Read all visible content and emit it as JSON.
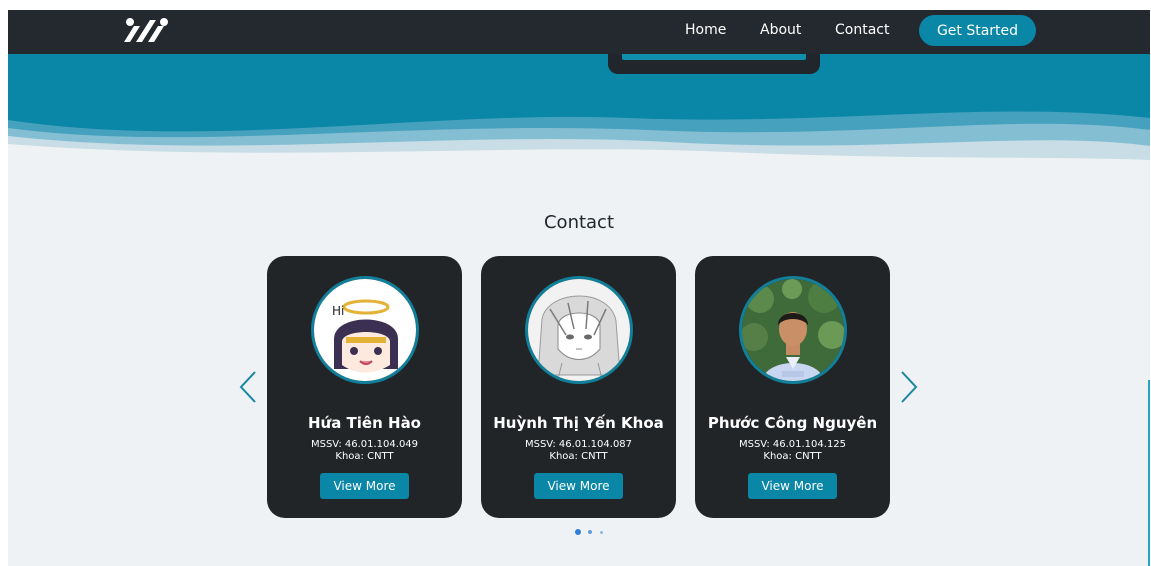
{
  "nav": {
    "home": "Home",
    "about": "About",
    "contact": "Contact",
    "cta": "Get Started"
  },
  "section": {
    "title": "Contact"
  },
  "cards": [
    {
      "name": "Hứa Tiên Hào",
      "mssv": "MSSV: 46.01.104.049",
      "khoa": "Khoa: CNTT",
      "button": "View More",
      "avatar_icon": "anime-girl-hi-avatar"
    },
    {
      "name": "Huỳnh Thị Yến Khoa",
      "mssv": "MSSV: 46.01.104.087",
      "khoa": "Khoa: CNTT",
      "button": "View More",
      "avatar_icon": "sketch-character-avatar"
    },
    {
      "name": "Phước Công Nguyên",
      "mssv": "MSSV: 46.01.104.125",
      "khoa": "Khoa: CNTT",
      "button": "View More",
      "avatar_icon": "student-photo-avatar"
    }
  ],
  "carousel": {
    "active_page": 1,
    "page_count": 3
  },
  "colors": {
    "brand": "#0a86a6",
    "navbar": "#24292f",
    "card": "#222528",
    "background": "#eef2f4"
  }
}
